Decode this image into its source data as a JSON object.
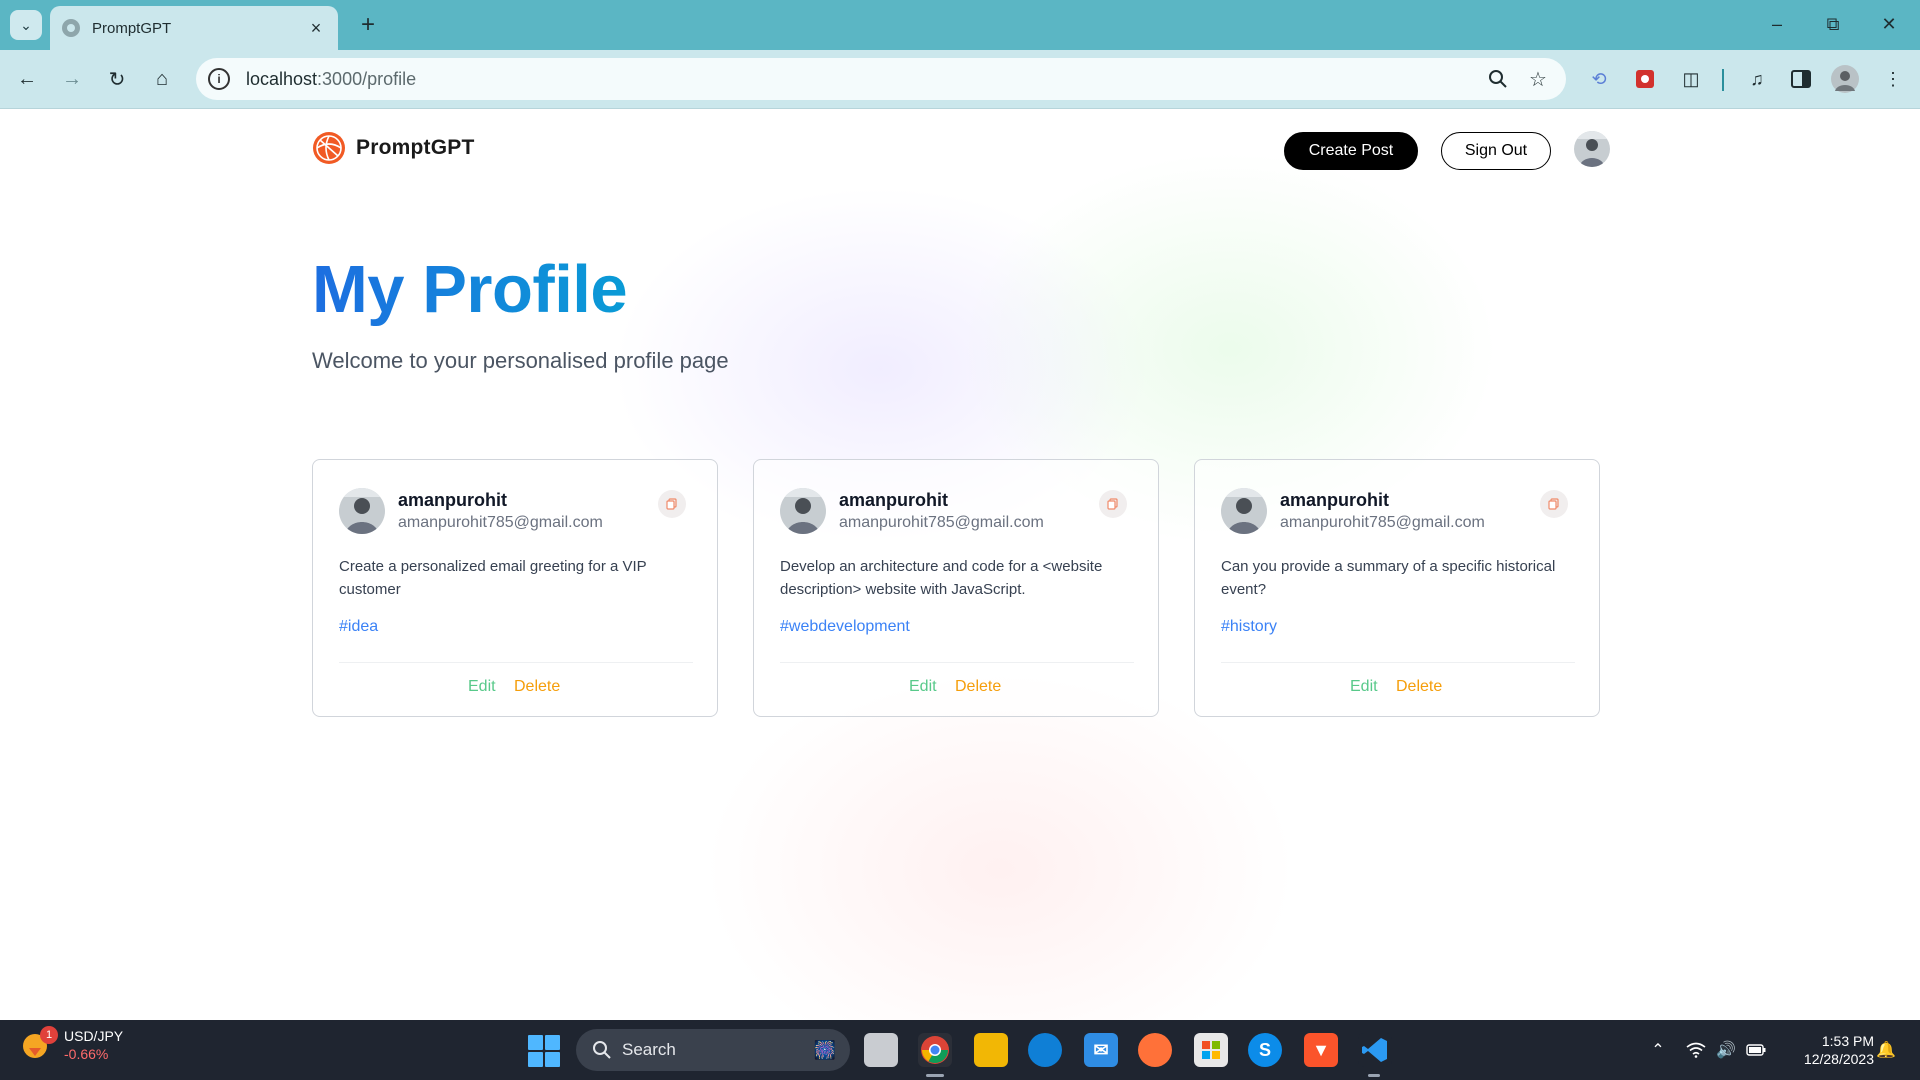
{
  "browser": {
    "tab_title": "PromptGPT",
    "url_host": "localhost",
    "url_path": ":3000/profile"
  },
  "app": {
    "brand": "PromptGPT",
    "create_post_label": "Create Post",
    "sign_out_label": "Sign Out"
  },
  "profile": {
    "title": "My Profile",
    "subtitle": "Welcome to your personalised profile page"
  },
  "posts": [
    {
      "username": "amanpurohit",
      "email": "amanpurohit785@gmail.com",
      "prompt": "Create a personalized email greeting for a VIP customer",
      "tag": "#idea",
      "edit_label": "Edit",
      "delete_label": "Delete"
    },
    {
      "username": "amanpurohit",
      "email": "amanpurohit785@gmail.com",
      "prompt": "Develop an architecture and code for a <website description> website with JavaScript.",
      "tag": "#webdevelopment",
      "edit_label": "Edit",
      "delete_label": "Delete"
    },
    {
      "username": "amanpurohit",
      "email": "amanpurohit785@gmail.com",
      "prompt": "Can you provide a summary of a specific historical event?",
      "tag": "#history",
      "edit_label": "Edit",
      "delete_label": "Delete"
    }
  ],
  "taskbar": {
    "widget_badge": "1",
    "widget_pair": "USD/JPY",
    "widget_change": "-0.66%",
    "search_label": "Search",
    "time": "1:53 PM",
    "date": "12/28/2023"
  },
  "colors": {
    "tabstrip": "#5bb6c4",
    "toolbar": "#cbe7ec",
    "heading_gradient_start": "#1d6ee0",
    "heading_gradient_end": "#0a9bd6",
    "tag": "#3b82f6",
    "edit": "#58c98a",
    "delete": "#f59e0b",
    "logo": "#f15a24"
  }
}
